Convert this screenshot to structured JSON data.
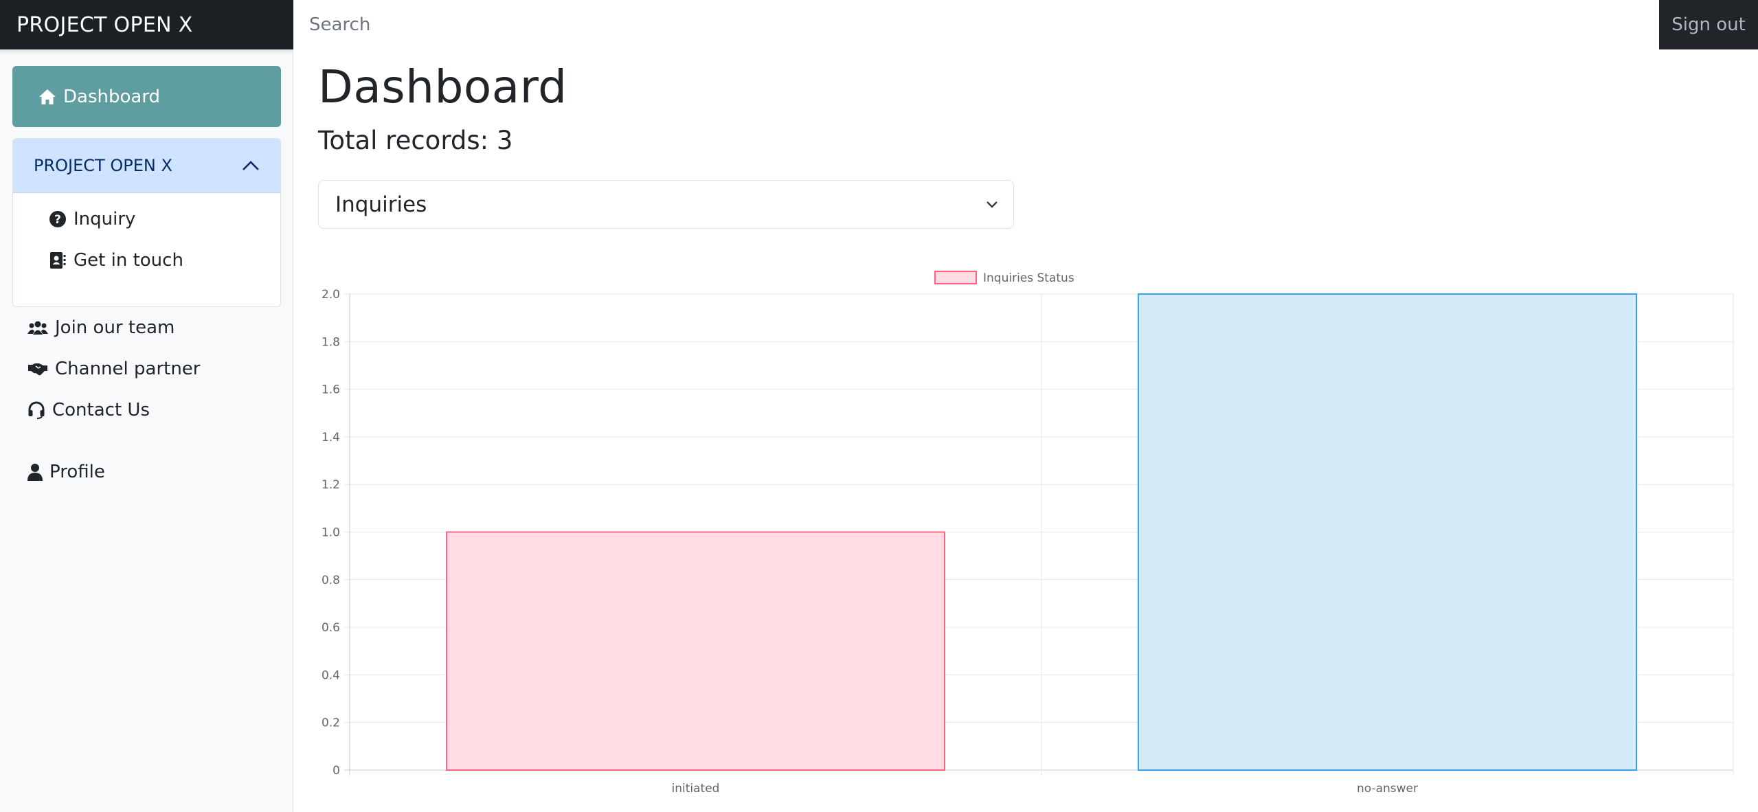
{
  "navbar": {
    "brand": "PROJECT OPEN X",
    "search_placeholder": "Search",
    "signout_label": "Sign out"
  },
  "sidebar": {
    "dashboard_label": "Dashboard",
    "accordion": {
      "title": "PROJECT OPEN X",
      "items": [
        {
          "label": "Inquiry",
          "icon": "question-circle-icon"
        },
        {
          "label": "Get in touch",
          "icon": "contact-book-icon"
        }
      ]
    },
    "links": [
      {
        "label": "Join our team",
        "icon": "users-icon"
      },
      {
        "label": "Channel partner",
        "icon": "handshake-icon"
      },
      {
        "label": "Contact Us",
        "icon": "headset-icon"
      },
      {
        "label": "Profile",
        "icon": "user-icon"
      }
    ]
  },
  "main": {
    "title": "Dashboard",
    "total_records": "Total records: 3",
    "select_value": "Inquiries"
  },
  "chart_data": {
    "type": "bar",
    "categories": [
      "initiated",
      "no-answer"
    ],
    "values": [
      1,
      2
    ],
    "series": [
      {
        "name": "Inquiries Status",
        "values": [
          1,
          2
        ]
      }
    ],
    "bar_fill_colors": [
      "#ffdce4",
      "#d7eaf8"
    ],
    "bar_border_colors": [
      "#ff6384",
      "#36a2eb"
    ],
    "ylim": [
      0,
      2.0
    ],
    "yticks": [
      "0",
      "0.2",
      "0.4",
      "0.6",
      "0.8",
      "1.0",
      "1.2",
      "1.4",
      "1.6",
      "1.8",
      "2.0"
    ],
    "grid": true,
    "legend": "top-center"
  }
}
